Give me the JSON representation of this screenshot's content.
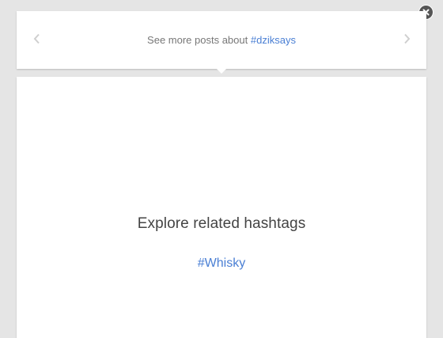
{
  "header": {
    "prefix_text": "See more posts about",
    "hashtag": "#dziksays"
  },
  "icons": {
    "close": "close-icon",
    "prev": "chevron-left-icon",
    "next": "chevron-right-icon"
  },
  "main": {
    "title": "Explore related hashtags",
    "related_hashtags": [
      {
        "label": "#Whisky"
      }
    ]
  },
  "colors": {
    "background": "#e5e5e5",
    "link": "#4a7fd4",
    "muted_text": "#777777",
    "close_button": "#555555"
  }
}
